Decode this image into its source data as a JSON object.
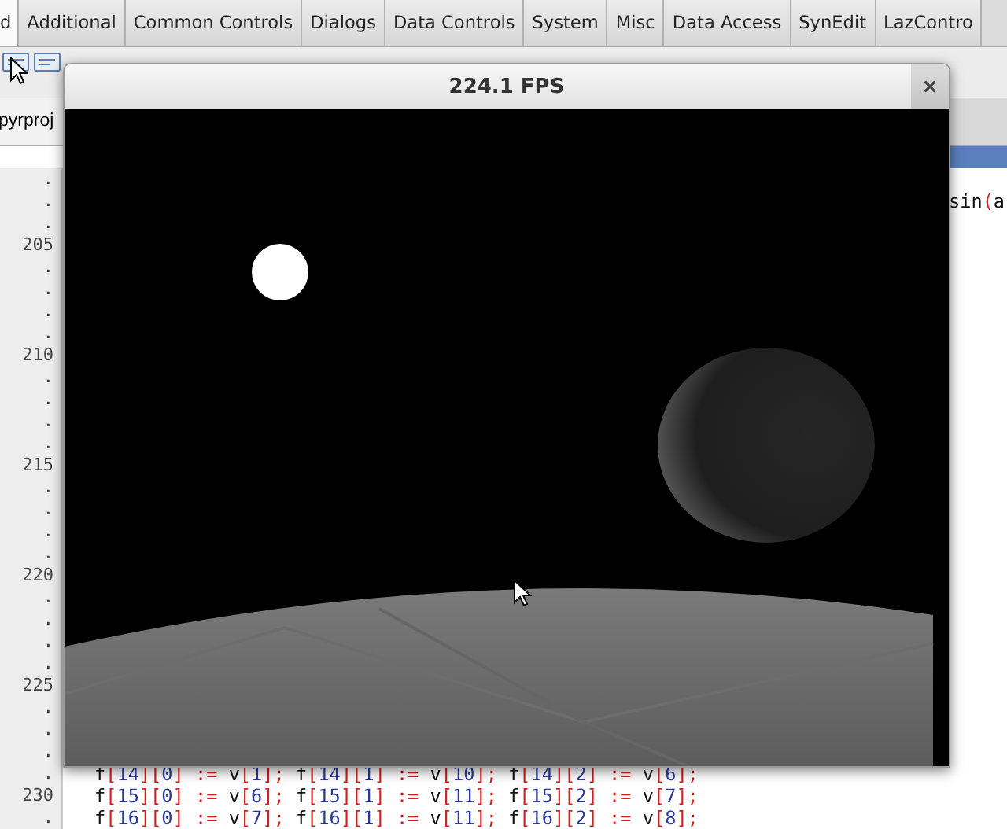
{
  "palette_tabs": [
    {
      "label": "d",
      "selected": true
    },
    {
      "label": "Additional",
      "selected": false
    },
    {
      "label": "Common Controls",
      "selected": false
    },
    {
      "label": "Dialogs",
      "selected": false
    },
    {
      "label": "Data Controls",
      "selected": false
    },
    {
      "label": "System",
      "selected": false
    },
    {
      "label": "Misc",
      "selected": false
    },
    {
      "label": "Data Access",
      "selected": false
    },
    {
      "label": "SynEdit",
      "selected": false
    },
    {
      "label": "LazContro",
      "selected": false
    }
  ],
  "editor_tab": {
    "label": "pyrproj"
  },
  "editor_rows": [
    {
      "number": "."
    },
    {
      "number": ".",
      "code": "sin(a",
      "kind": "tail"
    },
    {
      "number": "."
    },
    {
      "number": "205"
    },
    {
      "number": "."
    },
    {
      "number": "."
    },
    {
      "number": "."
    },
    {
      "number": "."
    },
    {
      "number": "210"
    },
    {
      "number": "."
    },
    {
      "number": "."
    },
    {
      "number": "."
    },
    {
      "number": "."
    },
    {
      "number": "215"
    },
    {
      "number": "."
    },
    {
      "number": "."
    },
    {
      "number": "."
    },
    {
      "number": "."
    },
    {
      "number": "220"
    },
    {
      "number": "."
    },
    {
      "number": "."
    },
    {
      "number": "."
    },
    {
      "number": "."
    },
    {
      "number": "225"
    },
    {
      "number": "."
    },
    {
      "number": "."
    },
    {
      "number": "."
    },
    {
      "number": ".",
      "code": "f[14][0] := v[1]; f[14][1] := v[10]; f[14][2] := v[6];",
      "kind": "line"
    },
    {
      "number": "230",
      "code": "f[15][0] := v[6]; f[15][1] := v[11]; f[15][2] := v[7];",
      "kind": "line"
    },
    {
      "number": ".",
      "code": "f[16][0] := v[7]; f[16][1] := v[11]; f[16][2] := v[8];",
      "kind": "line"
    }
  ],
  "window": {
    "title": "224.1 FPS",
    "close": "×"
  }
}
